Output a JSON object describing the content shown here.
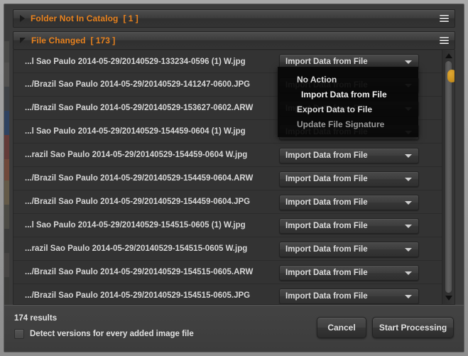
{
  "accent_color": "#e8821e",
  "scroll_thumb_color": "#c8901f",
  "sections": [
    {
      "title": "Folder Not In Catalog",
      "count": "[ 1 ]",
      "expanded": false,
      "menu_icon": "hamburger-icon",
      "toggle_icon": "triangle-right-icon"
    },
    {
      "title": "File Changed",
      "count": "[ 173 ]",
      "expanded": true,
      "menu_icon": "hamburger-icon",
      "toggle_icon": "triangle-down-icon"
    }
  ],
  "action_label": "Import Data from File",
  "rows": [
    {
      "file": "...l Sao Paulo 2014-05-29/20140529-133234-0596 (1) W.jpg",
      "action": "Import Data from File"
    },
    {
      "file": ".../Brazil Sao Paulo 2014-05-29/20140529-141247-0600.JPG",
      "action": "Import Data from File"
    },
    {
      "file": ".../Brazil Sao Paulo 2014-05-29/20140529-153627-0602.ARW",
      "action": "Import Data from File"
    },
    {
      "file": "...l Sao Paulo 2014-05-29/20140529-154459-0604 (1) W.jpg",
      "action": "Import Data from File"
    },
    {
      "file": "...razil Sao Paulo 2014-05-29/20140529-154459-0604 W.jpg",
      "action": "Import Data from File"
    },
    {
      "file": ".../Brazil Sao Paulo 2014-05-29/20140529-154459-0604.ARW",
      "action": "Import Data from File"
    },
    {
      "file": ".../Brazil Sao Paulo 2014-05-29/20140529-154459-0604.JPG",
      "action": "Import Data from File"
    },
    {
      "file": "...l Sao Paulo 2014-05-29/20140529-154515-0605 (1) W.jpg",
      "action": "Import Data from File"
    },
    {
      "file": "...razil Sao Paulo 2014-05-29/20140529-154515-0605 W.jpg",
      "action": "Import Data from File"
    },
    {
      "file": ".../Brazil Sao Paulo 2014-05-29/20140529-154515-0605.ARW",
      "action": "Import Data from File"
    },
    {
      "file": ".../Brazil Sao Paulo 2014-05-29/20140529-154515-0605.JPG",
      "action": "Import Data from File"
    }
  ],
  "open_menu": {
    "anchor_row_index": 1,
    "items": [
      {
        "label": "No Action",
        "selected": false
      },
      {
        "label": "Import Data from File",
        "selected": true
      },
      {
        "label": "Export Data to File",
        "selected": false
      },
      {
        "label": "Update File Signature",
        "selected": false
      }
    ]
  },
  "scrollbar": {
    "up_icon": "triangle-up-icon",
    "down_icon": "triangle-down-icon",
    "thumb_position_percent": 4
  },
  "footer": {
    "results_text": "174 results",
    "detect_versions_label": "Detect versions for every added image file",
    "detect_versions_checked": false,
    "cancel_label": "Cancel",
    "start_processing_label": "Start Processing"
  }
}
